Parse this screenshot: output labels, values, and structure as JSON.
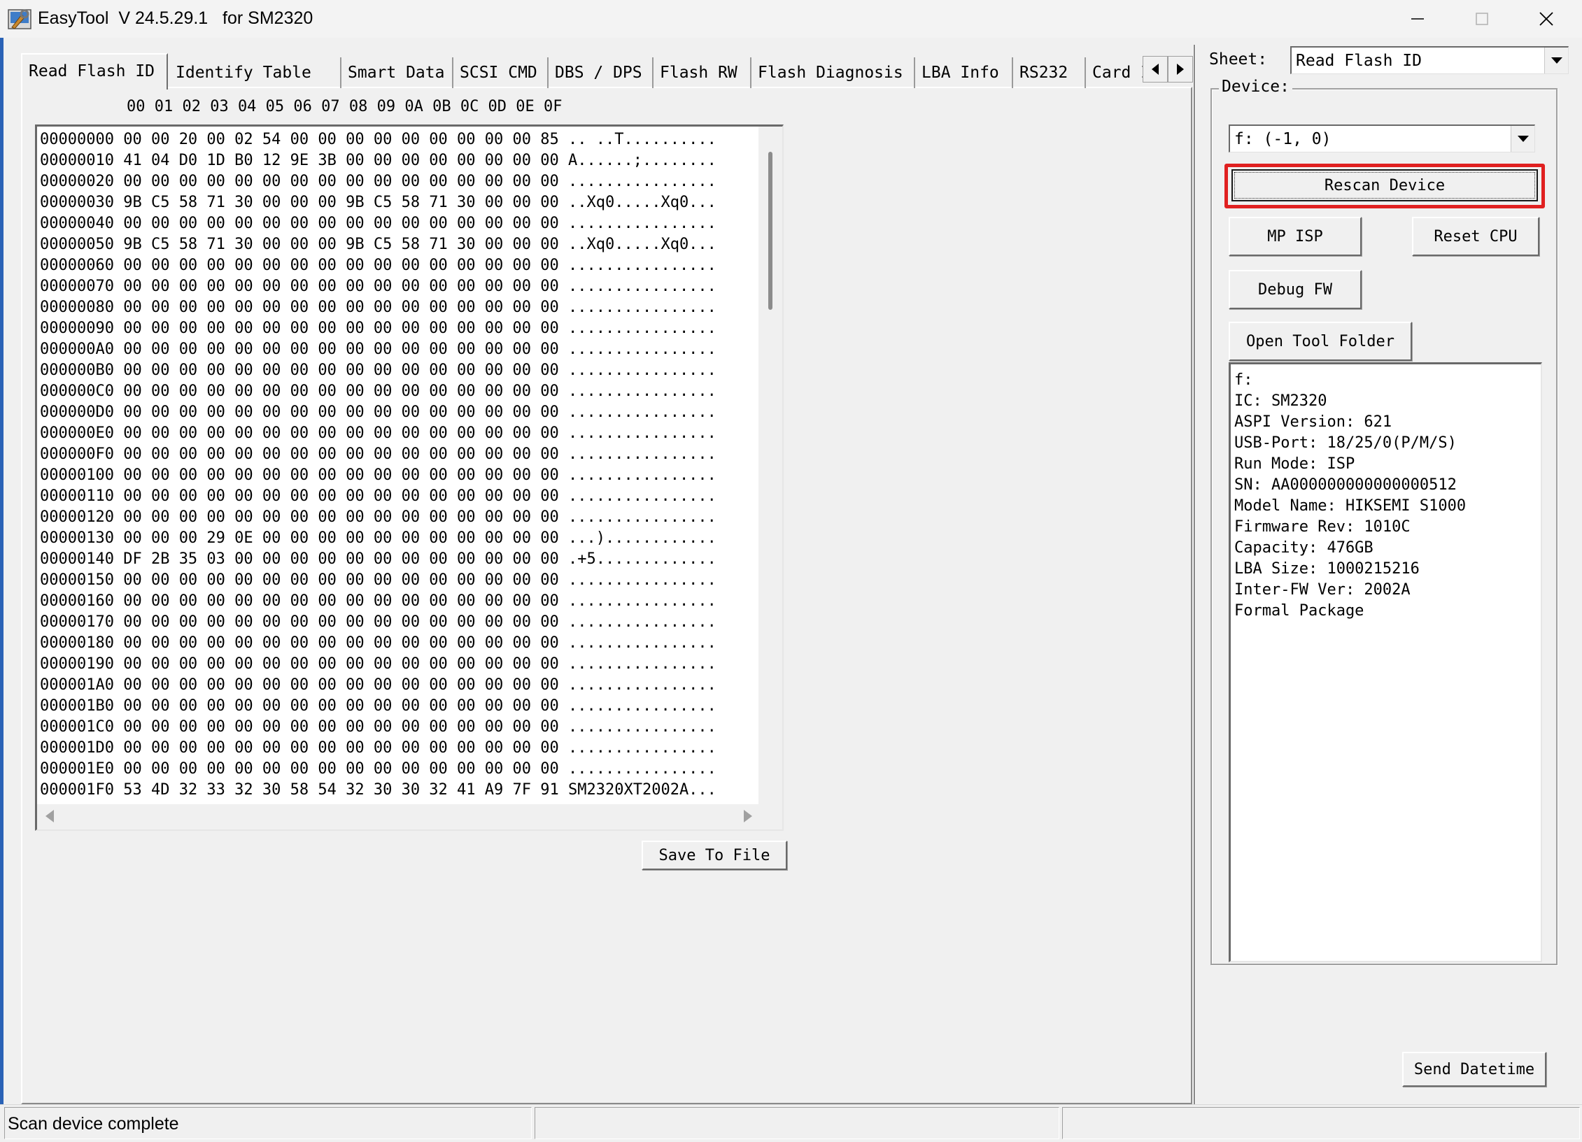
{
  "window": {
    "title": "EasyTool  V 24.5.29.1   for SM2320",
    "icons": {
      "app": "easytool-app-icon",
      "minimize": "minimize-icon",
      "maximize": "maximize-icon",
      "close": "close-icon"
    }
  },
  "tabs": [
    {
      "label": "Read Flash ID",
      "active": true
    },
    {
      "label": "Identify Table",
      "active": false
    },
    {
      "label": "Smart Data",
      "active": false
    },
    {
      "label": "SCSI CMD",
      "active": false
    },
    {
      "label": "DBS / DPS",
      "active": false
    },
    {
      "label": "Flash RW",
      "active": false
    },
    {
      "label": "Flash Diagnosis",
      "active": false
    },
    {
      "label": "LBA Info",
      "active": false
    },
    {
      "label": "RS232",
      "active": false
    },
    {
      "label": "Card In",
      "active": false
    }
  ],
  "hex": {
    "header": "00 01 02 03 04 05 06 07 08 09 0A 0B 0C 0D 0E 0F",
    "rows": [
      {
        "addr": "00000000",
        "bytes": "00 00 20 00 02 54 00 00 00 00 00 00 00 00 00 85",
        "ascii": ".. ..T.........."
      },
      {
        "addr": "00000010",
        "bytes": "41 04 D0 1D B0 12 9E 3B 00 00 00 00 00 00 00 00",
        "ascii": "A......;........"
      },
      {
        "addr": "00000020",
        "bytes": "00 00 00 00 00 00 00 00 00 00 00 00 00 00 00 00",
        "ascii": "................"
      },
      {
        "addr": "00000030",
        "bytes": "9B C5 58 71 30 00 00 00 9B C5 58 71 30 00 00 00",
        "ascii": "..Xq0.....Xq0..."
      },
      {
        "addr": "00000040",
        "bytes": "00 00 00 00 00 00 00 00 00 00 00 00 00 00 00 00",
        "ascii": "................"
      },
      {
        "addr": "00000050",
        "bytes": "9B C5 58 71 30 00 00 00 9B C5 58 71 30 00 00 00",
        "ascii": "..Xq0.....Xq0..."
      },
      {
        "addr": "00000060",
        "bytes": "00 00 00 00 00 00 00 00 00 00 00 00 00 00 00 00",
        "ascii": "................"
      },
      {
        "addr": "00000070",
        "bytes": "00 00 00 00 00 00 00 00 00 00 00 00 00 00 00 00",
        "ascii": "................"
      },
      {
        "addr": "00000080",
        "bytes": "00 00 00 00 00 00 00 00 00 00 00 00 00 00 00 00",
        "ascii": "................"
      },
      {
        "addr": "00000090",
        "bytes": "00 00 00 00 00 00 00 00 00 00 00 00 00 00 00 00",
        "ascii": "................"
      },
      {
        "addr": "000000A0",
        "bytes": "00 00 00 00 00 00 00 00 00 00 00 00 00 00 00 00",
        "ascii": "................"
      },
      {
        "addr": "000000B0",
        "bytes": "00 00 00 00 00 00 00 00 00 00 00 00 00 00 00 00",
        "ascii": "................"
      },
      {
        "addr": "000000C0",
        "bytes": "00 00 00 00 00 00 00 00 00 00 00 00 00 00 00 00",
        "ascii": "................"
      },
      {
        "addr": "000000D0",
        "bytes": "00 00 00 00 00 00 00 00 00 00 00 00 00 00 00 00",
        "ascii": "................"
      },
      {
        "addr": "000000E0",
        "bytes": "00 00 00 00 00 00 00 00 00 00 00 00 00 00 00 00",
        "ascii": "................"
      },
      {
        "addr": "000000F0",
        "bytes": "00 00 00 00 00 00 00 00 00 00 00 00 00 00 00 00",
        "ascii": "................"
      },
      {
        "addr": "00000100",
        "bytes": "00 00 00 00 00 00 00 00 00 00 00 00 00 00 00 00",
        "ascii": "................"
      },
      {
        "addr": "00000110",
        "bytes": "00 00 00 00 00 00 00 00 00 00 00 00 00 00 00 00",
        "ascii": "................"
      },
      {
        "addr": "00000120",
        "bytes": "00 00 00 00 00 00 00 00 00 00 00 00 00 00 00 00",
        "ascii": "................"
      },
      {
        "addr": "00000130",
        "bytes": "00 00 00 29 0E 00 00 00 00 00 00 00 00 00 00 00",
        "ascii": "...)............"
      },
      {
        "addr": "00000140",
        "bytes": "DF 2B 35 03 00 00 00 00 00 00 00 00 00 00 00 00",
        "ascii": ".+5............."
      },
      {
        "addr": "00000150",
        "bytes": "00 00 00 00 00 00 00 00 00 00 00 00 00 00 00 00",
        "ascii": "................"
      },
      {
        "addr": "00000160",
        "bytes": "00 00 00 00 00 00 00 00 00 00 00 00 00 00 00 00",
        "ascii": "................"
      },
      {
        "addr": "00000170",
        "bytes": "00 00 00 00 00 00 00 00 00 00 00 00 00 00 00 00",
        "ascii": "................"
      },
      {
        "addr": "00000180",
        "bytes": "00 00 00 00 00 00 00 00 00 00 00 00 00 00 00 00",
        "ascii": "................"
      },
      {
        "addr": "00000190",
        "bytes": "00 00 00 00 00 00 00 00 00 00 00 00 00 00 00 00",
        "ascii": "................"
      },
      {
        "addr": "000001A0",
        "bytes": "00 00 00 00 00 00 00 00 00 00 00 00 00 00 00 00",
        "ascii": "................"
      },
      {
        "addr": "000001B0",
        "bytes": "00 00 00 00 00 00 00 00 00 00 00 00 00 00 00 00",
        "ascii": "................"
      },
      {
        "addr": "000001C0",
        "bytes": "00 00 00 00 00 00 00 00 00 00 00 00 00 00 00 00",
        "ascii": "................"
      },
      {
        "addr": "000001D0",
        "bytes": "00 00 00 00 00 00 00 00 00 00 00 00 00 00 00 00",
        "ascii": "................"
      },
      {
        "addr": "000001E0",
        "bytes": "00 00 00 00 00 00 00 00 00 00 00 00 00 00 00 00",
        "ascii": "................"
      },
      {
        "addr": "000001F0",
        "bytes": "53 4D 32 33 32 30 58 54 32 30 30 32 41 A9 7F 91",
        "ascii": "SM2320XT2002A..."
      }
    ]
  },
  "buttons": {
    "save_to_file": "Save To File",
    "rescan_device": "Rescan Device",
    "mp_isp": "MP ISP",
    "reset_cpu": "Reset CPU",
    "debug_fw": "Debug FW",
    "open_tool_folder": "Open Tool Folder",
    "send_datetime": "Send Datetime"
  },
  "sheet": {
    "label": "Sheet:",
    "value": "Read Flash ID"
  },
  "device": {
    "label": "Device:",
    "value": "f: (-1, 0)"
  },
  "device_info": [
    "f:",
    "IC: SM2320",
    "ASPI Version: 621",
    "USB-Port: 18/25/0(P/M/S)",
    "Run Mode: ISP",
    "SN: AA000000000000000512",
    "Model Name: HIKSEMI S1000",
    "Firmware Rev: 1010C",
    "Capacity: 476GB",
    "LBA Size: 1000215216",
    "Inter-FW Ver: 2002A",
    "Formal Package"
  ],
  "status": {
    "text": "Scan device complete"
  },
  "colors": {
    "accent": "#2a62b6",
    "highlight": "#e02020",
    "background": "#f0f0f0"
  }
}
